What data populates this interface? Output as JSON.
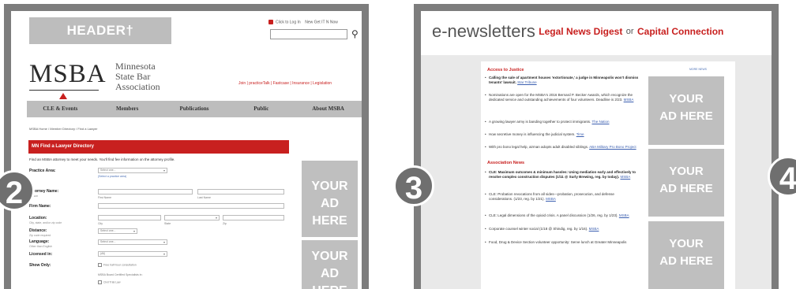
{
  "badges": {
    "b2": "2",
    "b3": "3",
    "b4": "4"
  },
  "panel_a": {
    "header_label": "HEADER†",
    "login_text": "Click to Log In",
    "new_text": "New Get IT N Now",
    "logo": "MSBA",
    "org_name": [
      "Minnesota",
      "State Bar",
      "Association"
    ],
    "top_links": "Join | practiceTalk | Fastcase | Insurance | Legislation",
    "nav": [
      "CLE & Events",
      "Members",
      "Publications",
      "Public",
      "About MSBA"
    ],
    "breadcrumb": "MSBA Home / Member Directory / Find a Lawyer",
    "directory_title": "MN Find a Lawyer Directory",
    "intro": "Find an MSBA attorney to meet your needs. You'll find fee information on the attorney profile.",
    "form": {
      "practice_area": "Practice Area:",
      "attorney_name": "Attorney Name:",
      "attorney_name_sub": "Person",
      "firm_name": "Firm Name:",
      "location": "Location:",
      "location_sub": "City, state, and/or zip code",
      "distance": "Distance:",
      "distance_sub": "Zip code required",
      "language": "Language:",
      "language_sub": "Other than English",
      "licensed_in": "Licensed in:",
      "show_only": "Show Only:",
      "select_placeholder": "Select one...",
      "add_practice": "(Select a practice area)",
      "first_name": "First Name",
      "last_name": "Last Name",
      "city": "City",
      "state": "State",
      "zip": "Zip",
      "licensed_value": "(All)",
      "free_consult": "Free half-hour consultation",
      "certified_label": "MSBA Board Certified Specialists in:",
      "civil_trial": "Civil Trial Law"
    },
    "ad1": [
      "YOUR",
      "AD HERE"
    ],
    "ad2": [
      "YOUR",
      "AD HERE"
    ]
  },
  "panel_b": {
    "title": "e-newsletters",
    "link1": "Legal News Digest",
    "or": "or",
    "link2": "Capital Connection",
    "section1": "Access to Justice",
    "section1_right": "MORE NEWS",
    "section2": "Association News",
    "items1": [
      {
        "bold": "Calling the sale of apartment houses 'extortionate,' a judge in Minneapolis won't dismiss tenants' lawsuit.",
        "link": "Star Tribune"
      },
      {
        "text": "Nominations are open for the MSBA's 2016 Bernard P. Becker Awards, which recognize the dedicated service and outstanding achievements of four volunteers. Deadline is 2/23.",
        "link": "MSBA"
      },
      {
        "text": "A growing lawyer army is banding together to protect immigrants.",
        "link": "The Nation"
      },
      {
        "text": "How secretive money is influencing the judicial system.",
        "link": "Time"
      },
      {
        "text": "With pro bono legal help, airman adopts adult disabled siblings.",
        "link": "ABA Military Pro Bono Project"
      }
    ],
    "items2": [
      {
        "bold": "CLE: Maximum outcomes & minimum hassles: Using mediation early and effectively to resolve complex construction disputes (1/11 @ Surly Brewing, reg. by today).",
        "link": "MSBA"
      },
      {
        "text": "CLE: Probation revocations from all sides—probation, prosecution, and defense considerations. (1/23, reg. by 1/21).",
        "link": "MSBA"
      },
      {
        "text": "CLE: Legal dimensions of the opioid crisis. A panel discussion (1/26, reg. by 1/23).",
        "link": "MSBA"
      },
      {
        "text": "Corporate counsel winter social (1/18 @ Shindig, reg. by 1/16).",
        "link": "MSBA"
      },
      {
        "text": "Food, Drug & Device Section volunteer opportunity: Serve lunch at Greater Minneapolis"
      }
    ],
    "ads": [
      [
        "YOUR",
        "AD HERE"
      ],
      [
        "YOUR",
        "AD HERE"
      ],
      [
        "YOUR",
        "AD HERE"
      ]
    ]
  }
}
